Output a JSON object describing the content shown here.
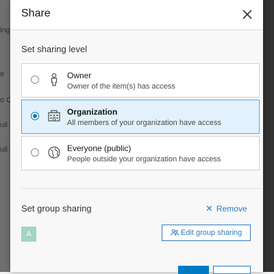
{
  "dialog": {
    "title": "Share"
  },
  "sharing_level": {
    "label": "Set sharing level",
    "options": [
      {
        "title": "Owner",
        "description": "Owner of the item(s) has access",
        "icon": "person-icon",
        "selected": false
      },
      {
        "title": "Organization",
        "description": "All members of your organization have access",
        "icon": "organization-icon",
        "selected": true
      },
      {
        "title": "Everyone (public)",
        "description": "People outside your organization have access",
        "icon": "globe-icon",
        "selected": false
      }
    ]
  },
  "group_sharing": {
    "label": "Set group sharing",
    "remove_label": "Remove",
    "group_avatar_letter": "A",
    "edit_label": "Edit group sharing"
  },
  "colors": {
    "accent": "#007ac2",
    "link": "#2b7bbf",
    "selected_bg": "#e2f1fb",
    "avatar_bg": "#a3d4c6"
  }
}
